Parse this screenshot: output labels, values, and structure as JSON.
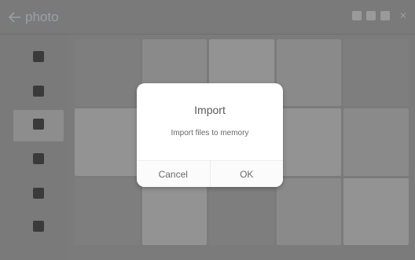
{
  "header": {
    "title": "photo",
    "action_text": "",
    "close_symbol": "✕"
  },
  "sidebar": {
    "items": [
      {
        "label": "",
        "icon": "grid-icon"
      },
      {
        "label": "",
        "icon": "device-icon"
      },
      {
        "label": "",
        "icon": "sd-card-icon"
      },
      {
        "label": "",
        "icon": "folder-icon"
      },
      {
        "label": "",
        "icon": "heart-icon"
      },
      {
        "label": "",
        "icon": "person-icon"
      }
    ]
  },
  "dialog": {
    "title": "Import",
    "message": "Import files to memory",
    "cancel_label": "Cancel",
    "ok_label": "OK"
  },
  "colors": {
    "overlay": "#7b7b7b",
    "dialog_bg": "#ffffff",
    "text": "#5a5a5a"
  }
}
